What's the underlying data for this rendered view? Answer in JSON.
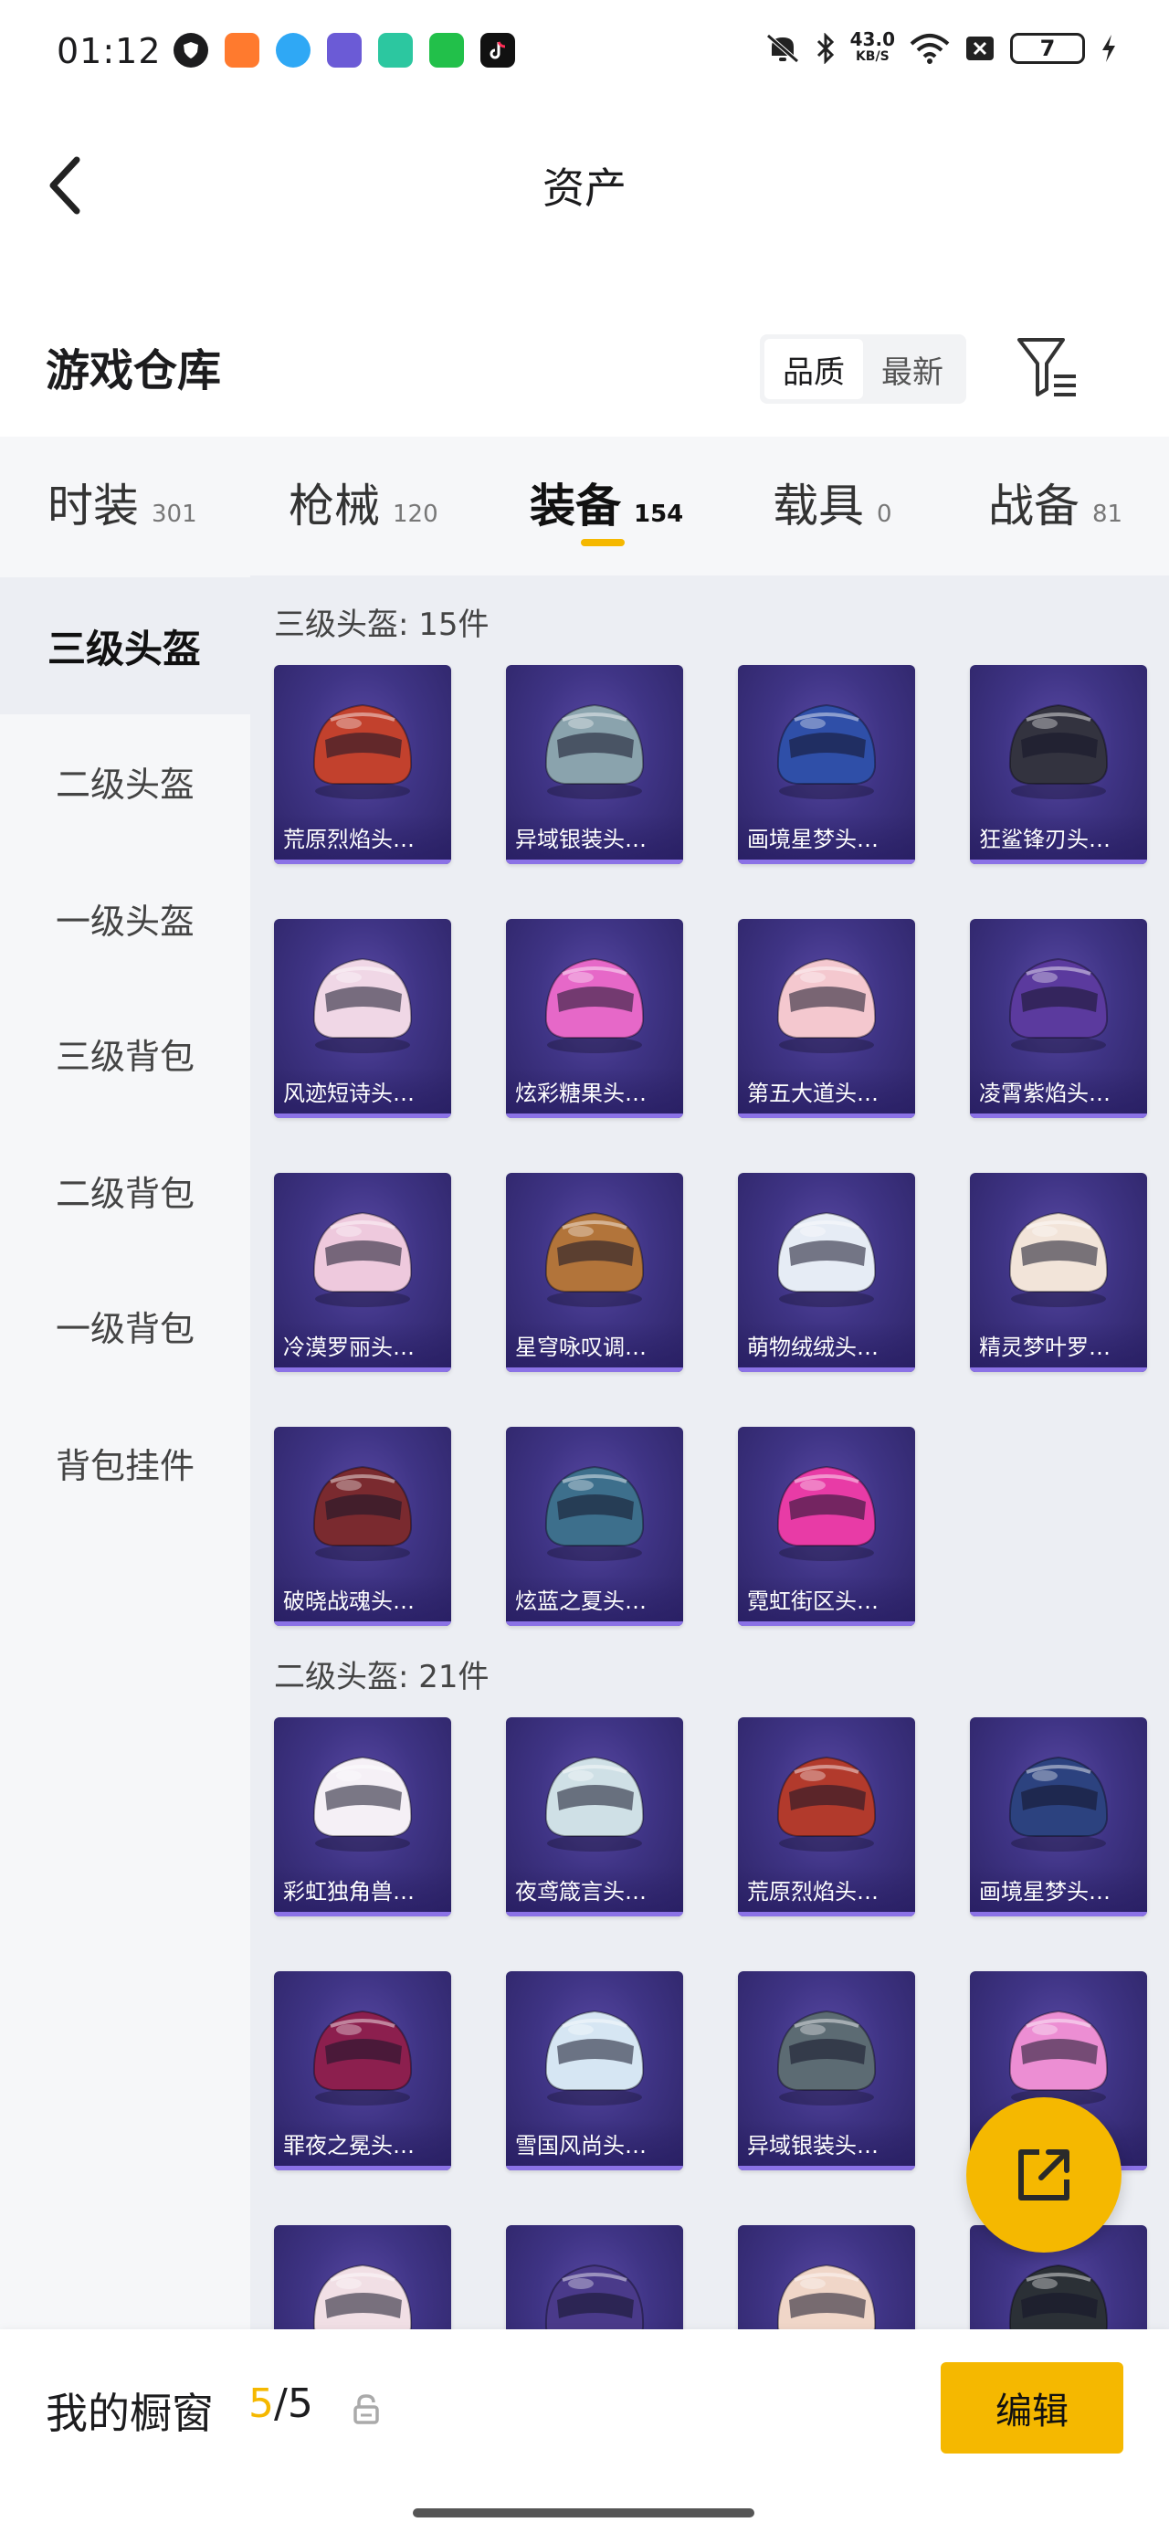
{
  "status_bar": {
    "time": "01:12",
    "net_speed_value": "43.0",
    "net_speed_unit": "KB/S",
    "battery": "7"
  },
  "nav": {
    "title": "资产"
  },
  "warehouse": {
    "title": "游戏仓库",
    "sort_options": [
      "品质",
      "最新"
    ]
  },
  "tabs": [
    {
      "label": "时装",
      "count": "301"
    },
    {
      "label": "枪械",
      "count": "120"
    },
    {
      "label": "装备",
      "count": "154"
    },
    {
      "label": "载具",
      "count": "0"
    },
    {
      "label": "战备",
      "count": "81"
    }
  ],
  "sidebar": {
    "items": [
      "三级头盔",
      "二级头盔",
      "一级头盔",
      "三级背包",
      "二级背包",
      "一级背包",
      "背包挂件"
    ]
  },
  "sections": [
    {
      "title": "三级头盔: 15件",
      "items": [
        {
          "name": "荒原烈焰头…",
          "color": "#c2412d"
        },
        {
          "name": "异域银装头…",
          "color": "#8aa3ad"
        },
        {
          "name": "画境星梦头…",
          "color": "#2f4fa8"
        },
        {
          "name": "狂鲨锋刃头…",
          "color": "#33333f"
        },
        {
          "name": "风迹短诗头…",
          "color": "#f0d7e6"
        },
        {
          "name": "炫彩糖果头…",
          "color": "#e668c8"
        },
        {
          "name": "第五大道头…",
          "color": "#f4c8cf"
        },
        {
          "name": "凌霄紫焰头…",
          "color": "#5b3a9e"
        },
        {
          "name": "冷漠罗丽头…",
          "color": "#eec9dd"
        },
        {
          "name": "星穹咏叹调…",
          "color": "#b2743a"
        },
        {
          "name": "萌物绒绒头…",
          "color": "#e6ecf5"
        },
        {
          "name": "精灵梦叶罗…",
          "color": "#f2e4d9"
        },
        {
          "name": "破晓战魂头…",
          "color": "#7a2a2f"
        },
        {
          "name": "炫蓝之夏头…",
          "color": "#3d6f8c"
        },
        {
          "name": "霓虹街区头…",
          "color": "#e83ba6"
        }
      ]
    },
    {
      "title": "二级头盔: 21件",
      "items": [
        {
          "name": "彩虹独角兽…",
          "color": "#f5f0f6"
        },
        {
          "name": "夜鸢箴言头…",
          "color": "#cfe0e6"
        },
        {
          "name": "荒原烈焰头…",
          "color": "#b23a2c"
        },
        {
          "name": "画境星梦头…",
          "color": "#2c427f"
        },
        {
          "name": "罪夜之冕头…",
          "color": "#8c1f4e"
        },
        {
          "name": "雪国风尚头…",
          "color": "#d6e6f3"
        },
        {
          "name": "异域银装头…",
          "color": "#5c6b73"
        },
        {
          "name": "",
          "color": "#ec8ed3"
        },
        {
          "name": "",
          "color": "#f1dfe5"
        },
        {
          "name": "",
          "color": "#4a3a8a"
        },
        {
          "name": "",
          "color": "#f0d6c8"
        },
        {
          "name": "",
          "color": "#2b3036"
        }
      ]
    }
  ],
  "bottom": {
    "showcase_label": "我的橱窗",
    "showcase_current": "5",
    "showcase_total": "/5",
    "edit_label": "编辑"
  }
}
